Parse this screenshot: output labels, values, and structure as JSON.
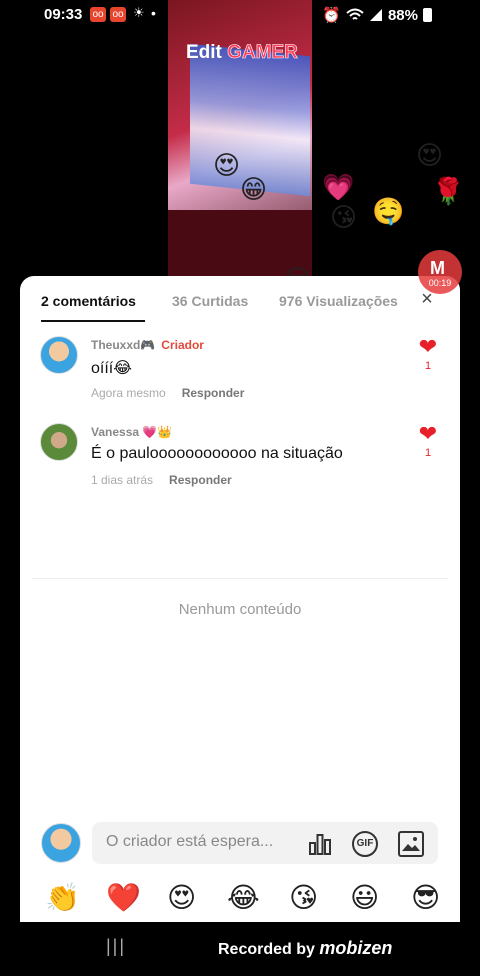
{
  "status_bar": {
    "time": "09:33",
    "battery": "88%",
    "notification_badges": [
      "oo",
      "oo"
    ],
    "extra_icon": "☀",
    "dot": "•"
  },
  "video": {
    "title_prefix": "Edit",
    "title_accent": "GAMER",
    "title_accent_color": "#ff3b5c"
  },
  "recording_badge": {
    "mark": "M",
    "timer": "00:19"
  },
  "sheet": {
    "tabs": [
      {
        "label": "2 comentários",
        "active": true
      },
      {
        "label": "36 Curtidas",
        "active": false
      },
      {
        "label": "976 Visualizações",
        "active": false
      }
    ],
    "close": "×",
    "comments": [
      {
        "author": "Theuxxd🎮",
        "badge": "Criador",
        "text": "oííí😂",
        "time": "Agora mesmo",
        "reply": "Responder",
        "likes": "1"
      },
      {
        "author": "Vanessa 💗👑",
        "badge": "",
        "text": "É o pauloooooooooooo na situação",
        "time": "1 dias atrás",
        "reply": "Responder",
        "likes": "1"
      }
    ],
    "empty_state": "Nenhum conteúdo",
    "input_placeholder": "O criador está espera...",
    "gif_label": "GIF",
    "emoji_bar": [
      "👏",
      "❤️",
      "😍",
      "😂",
      "😘",
      "😃",
      "😎"
    ]
  },
  "floating_emojis": [
    "😍",
    "😁",
    "😘",
    "🤤",
    "😍",
    "💗",
    "🌹",
    "😏",
    "😁",
    "🌹",
    "😘",
    "😍",
    "😁"
  ],
  "nav_bar": {
    "recent_apps": "|||",
    "recorded_by": "Recorded by",
    "brand": "mobizen"
  },
  "colors": {
    "accent_red": "#e8202a",
    "creator_red": "#e24b3b"
  }
}
